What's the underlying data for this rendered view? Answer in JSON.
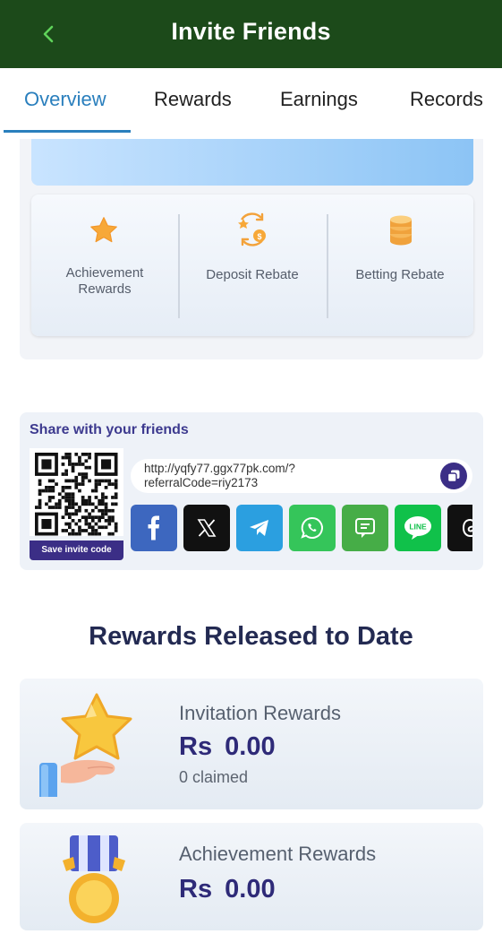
{
  "header": {
    "title": "Invite Friends",
    "back_icon": "chevron-left-icon"
  },
  "tabs": [
    {
      "label": "Overview",
      "active": true
    },
    {
      "label": "Rewards",
      "active": false
    },
    {
      "label": "Earnings",
      "active": false
    },
    {
      "label": "Records",
      "active": false
    }
  ],
  "rebates": [
    {
      "label_line1": "Achievement",
      "label_line2": "Rewards",
      "icon": "star-icon"
    },
    {
      "label_line1": "Deposit Rebate",
      "icon": "deposit-rebate-icon"
    },
    {
      "label_line1": "Betting Rebate",
      "icon": "coin-stack-icon"
    }
  ],
  "share": {
    "title": "Share with your friends",
    "save_label": "Save invite code",
    "link_line1": "http://yqfy77.ggx77pk.com/?",
    "link_line2": "referralCode=riy2173",
    "socials": [
      "facebook-icon",
      "x-icon",
      "telegram-icon",
      "whatsapp-icon",
      "sms-icon",
      "line-icon",
      "threads-icon"
    ],
    "line_label": "LINE"
  },
  "rewards_section": {
    "title": "Rewards Released to Date",
    "cards": [
      {
        "title": "Invitation Rewards",
        "currency": "Rs",
        "amount": "0.00",
        "claimed": "0 claimed"
      },
      {
        "title": "Achievement Rewards",
        "currency": "Rs",
        "amount": "0.00"
      }
    ]
  },
  "colors": {
    "header_bg": "#1c4a1a",
    "accent": "#2a7fbd",
    "brand_purple": "#3b2e86"
  }
}
